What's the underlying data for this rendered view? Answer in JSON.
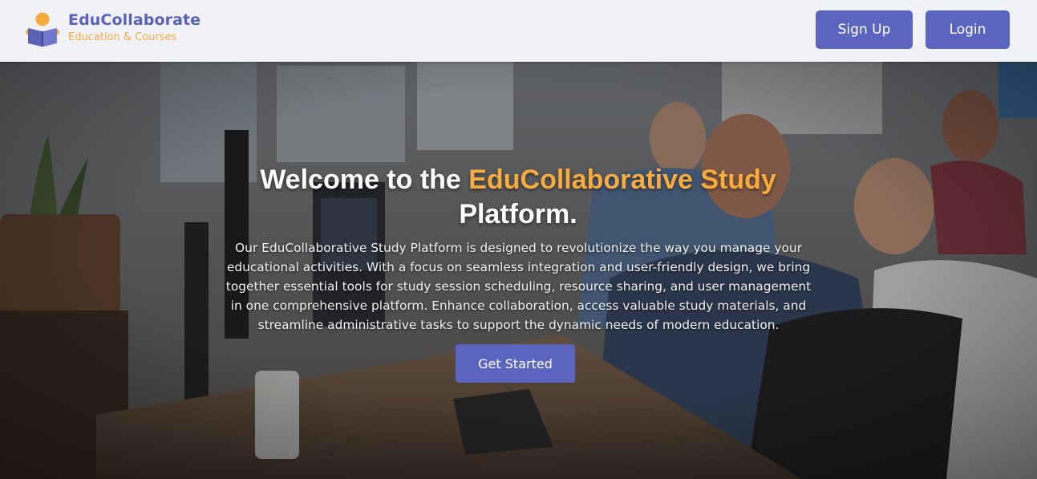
{
  "brand": {
    "title": "EduCollaborate",
    "subtitle": "Education & Courses",
    "logo_icon": "reading-book-icon"
  },
  "nav": {
    "signup_label": "Sign Up",
    "login_label": "Login"
  },
  "hero": {
    "headline_prefix": "Welcome to the ",
    "headline_accent": "EduCollaborative Study",
    "headline_suffix": "Platform.",
    "description": "Our EduCollaborative Study Platform is designed to revolutionize the way you manage your educational activities. With a focus on seamless integration and user-friendly design, we bring together essential tools for study session scheduling, resource sharing, and user management in one comprehensive platform. Enhance collaboration, access valuable study materials, and streamline administrative tasks to support the dynamic needs of modern education.",
    "cta_label": "Get Started",
    "background_image": "office-people-collaborating-photo"
  },
  "colors": {
    "primary": "#5b65bf",
    "brand_text": "#5863b8",
    "accent": "#f8ac3f",
    "header_bg": "#f1f2f7"
  }
}
